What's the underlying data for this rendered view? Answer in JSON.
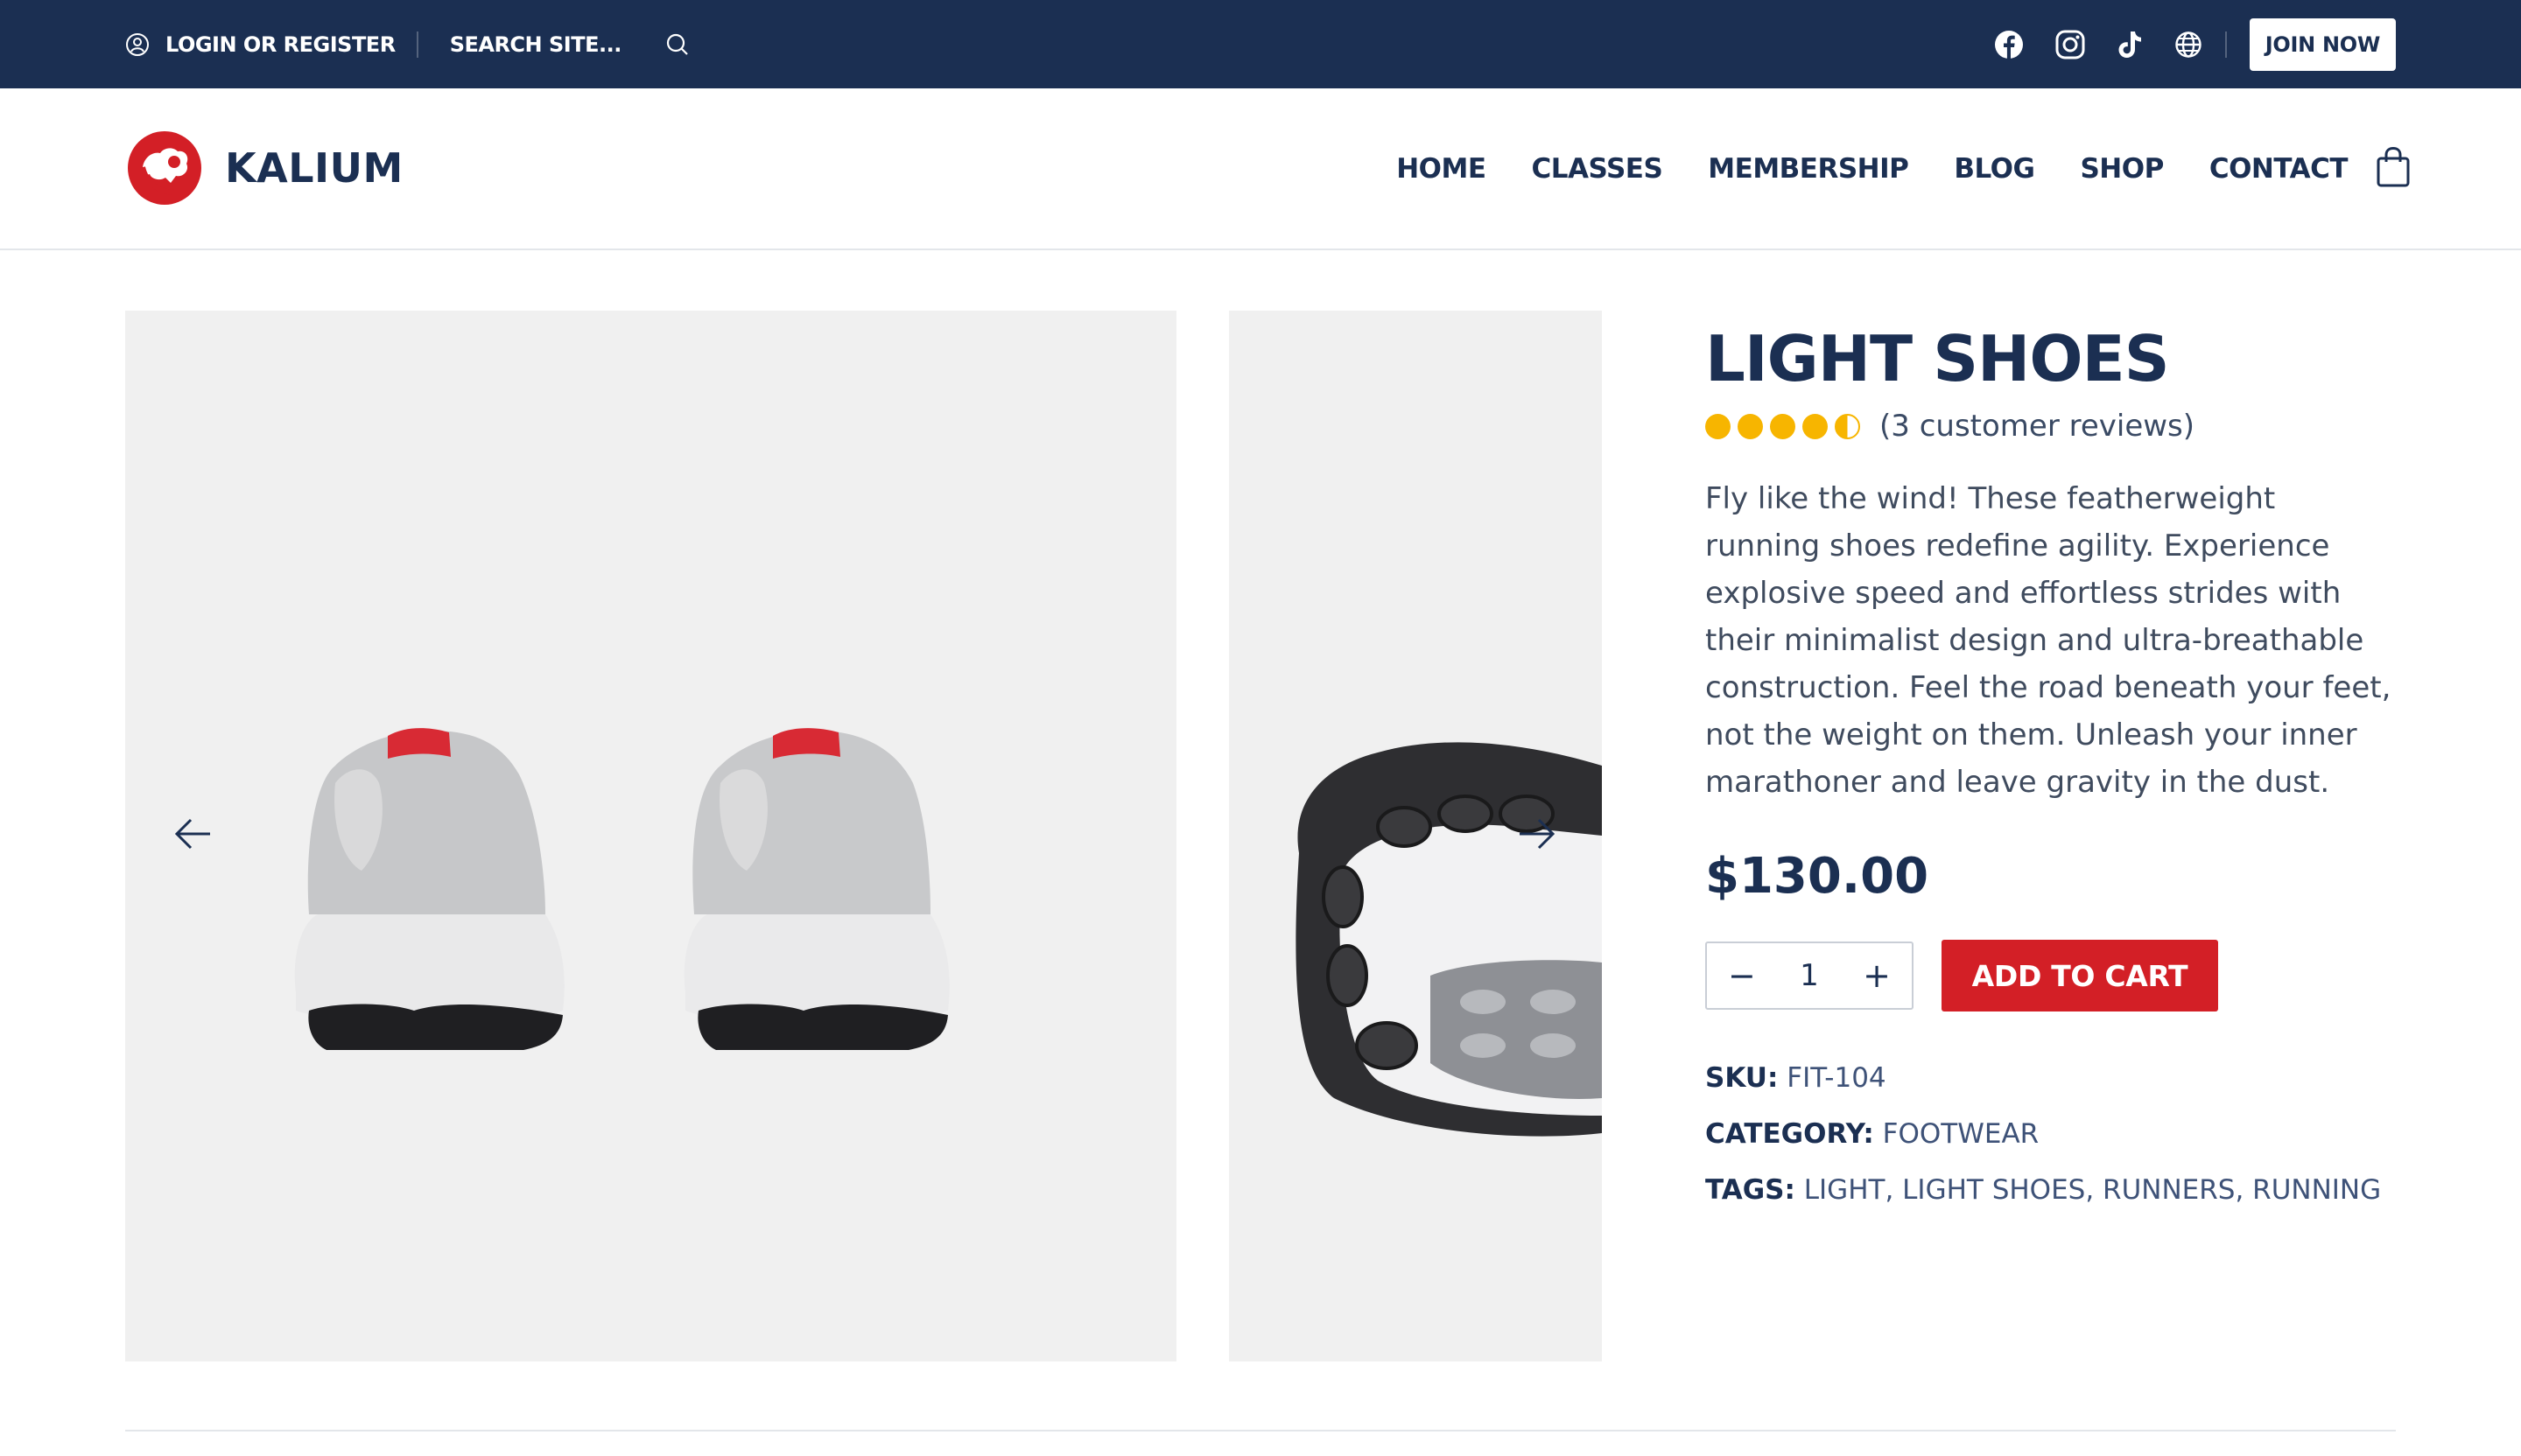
{
  "topbar": {
    "login_label": "LOGIN OR REGISTER",
    "search_placeholder": "SEARCH SITE...",
    "join_label": "JOIN NOW",
    "social_icons": [
      "facebook-icon",
      "instagram-icon",
      "tiktok-icon",
      "globe-icon"
    ],
    "background": "#1b2f52"
  },
  "brand": {
    "name": "KALIUM",
    "logo_color": "#d31f26"
  },
  "nav": {
    "items": [
      "HOME",
      "CLASSES",
      "MEMBERSHIP",
      "BLOG",
      "SHOP",
      "CONTACT"
    ]
  },
  "product": {
    "title": "LIGHT SHOES",
    "rating": 4.5,
    "rating_max": 5,
    "reviews_label": "(3 customer reviews)",
    "description": "Fly like the wind! These featherweight running shoes redefine agility. Experience explosive speed and effortless strides with their minimalist design and ultra-breathable construction. Feel the road beneath your feet, not the weight on them. Unleash your inner marathoner and leave gravity in the dust.",
    "price": "$130.00",
    "quantity": "1",
    "add_to_cart_label": "ADD TO CART",
    "sku_label": "SKU:",
    "sku_value": "FIT-104",
    "category_label": "CATEGORY:",
    "category_value": "FOOTWEAR",
    "tags_label": "TAGS:",
    "tags_value": "LIGHT, LIGHT SHOES, RUNNERS, RUNNING",
    "accent_color": "#d31f26",
    "star_color": "#f7b500"
  }
}
